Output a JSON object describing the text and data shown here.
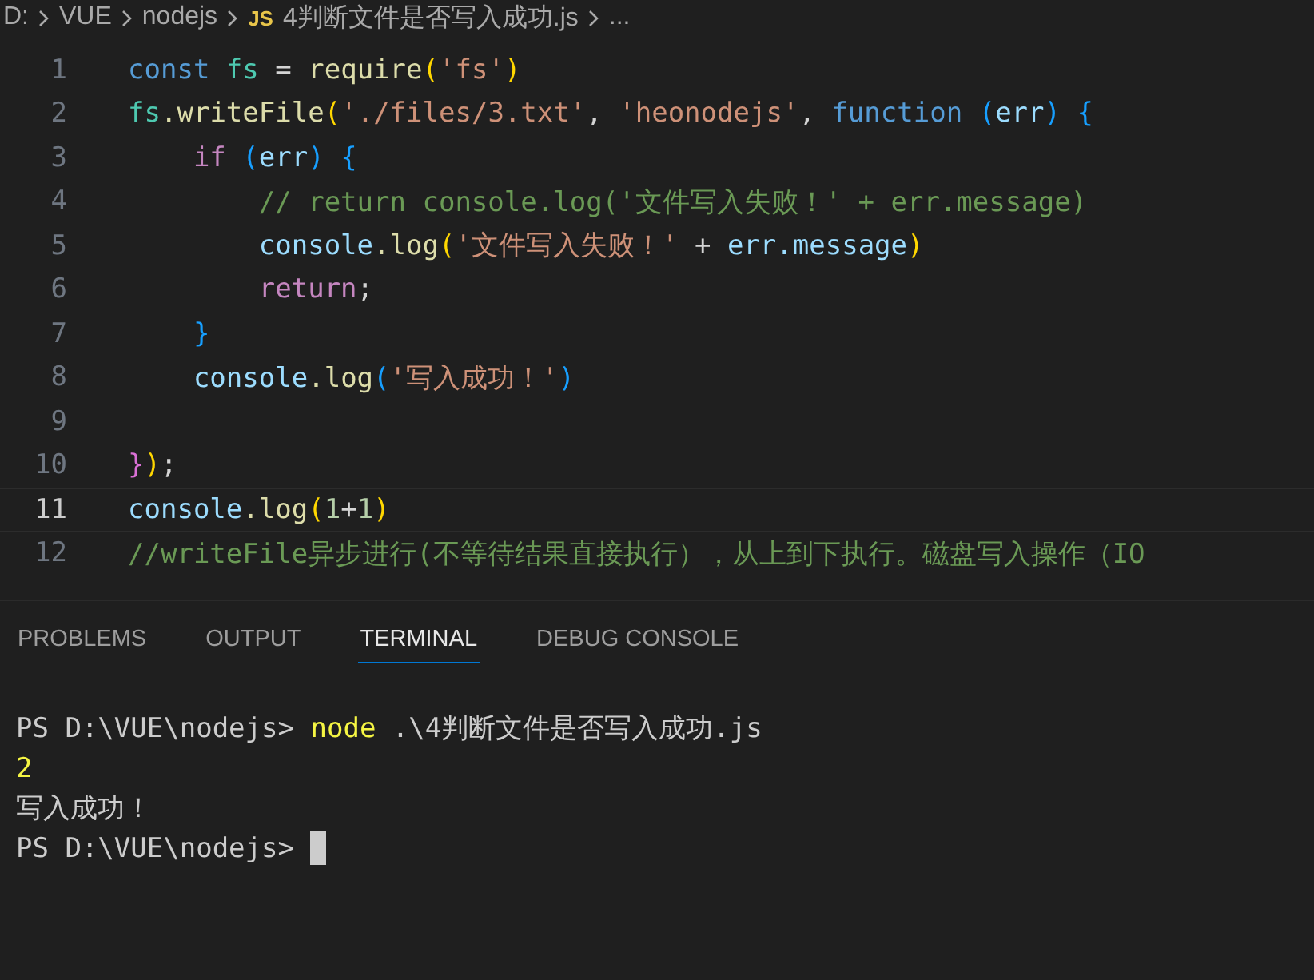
{
  "breadcrumb": [
    {
      "kind": "folder",
      "label": "D:"
    },
    {
      "kind": "folder",
      "label": "VUE"
    },
    {
      "kind": "folder",
      "label": "nodejs"
    },
    {
      "kind": "file",
      "badge": "JS",
      "label": "4判断文件是否写入成功.js"
    },
    {
      "kind": "more",
      "label": "..."
    }
  ],
  "editor": {
    "lines": [
      {
        "number": "1",
        "active": false,
        "tokens": [
          {
            "kind": "keyword",
            "text": "const "
          },
          {
            "kind": "type",
            "text": "fs"
          },
          {
            "kind": "plain",
            "text": " = "
          },
          {
            "kind": "function",
            "text": "require"
          },
          {
            "kind": "paren",
            "text": "("
          },
          {
            "kind": "string",
            "text": "'fs'"
          },
          {
            "kind": "paren",
            "text": ")"
          }
        ]
      },
      {
        "number": "2",
        "active": false,
        "tokens": [
          {
            "kind": "type",
            "text": "fs"
          },
          {
            "kind": "function",
            "text": ".writeFile"
          },
          {
            "kind": "paren",
            "text": "("
          },
          {
            "kind": "string",
            "text": "'./files/3.txt'"
          },
          {
            "kind": "plain",
            "text": ", "
          },
          {
            "kind": "string",
            "text": "'heonodejs'"
          },
          {
            "kind": "plain",
            "text": ", "
          },
          {
            "kind": "keyword",
            "text": "function "
          },
          {
            "kind": "bracket",
            "text": "("
          },
          {
            "kind": "variable",
            "text": "err"
          },
          {
            "kind": "bracket",
            "text": ")"
          },
          {
            "kind": "bracket",
            "text": " {"
          }
        ]
      },
      {
        "number": "3",
        "active": false,
        "tokens": [
          {
            "kind": "control",
            "text": "    if "
          },
          {
            "kind": "bracket",
            "text": "("
          },
          {
            "kind": "variable",
            "text": "err"
          },
          {
            "kind": "bracket",
            "text": ")"
          },
          {
            "kind": "bracket",
            "text": " {"
          }
        ]
      },
      {
        "number": "4",
        "active": false,
        "tokens": [
          {
            "kind": "comment",
            "text": "        // return console.log('文件写入失败！' + err.message)"
          }
        ]
      },
      {
        "number": "5",
        "active": false,
        "tokens": [
          {
            "kind": "variable",
            "text": "        console"
          },
          {
            "kind": "function",
            "text": ".log"
          },
          {
            "kind": "paren",
            "text": "("
          },
          {
            "kind": "string",
            "text": "'文件写入失败！'"
          },
          {
            "kind": "plain",
            "text": " + "
          },
          {
            "kind": "variable",
            "text": "err.message"
          },
          {
            "kind": "paren",
            "text": ")"
          }
        ]
      },
      {
        "number": "6",
        "active": false,
        "tokens": [
          {
            "kind": "control",
            "text": "        return"
          },
          {
            "kind": "plain",
            "text": ";"
          }
        ]
      },
      {
        "number": "7",
        "active": false,
        "tokens": [
          {
            "kind": "bracket",
            "text": "    }"
          }
        ]
      },
      {
        "number": "8",
        "active": false,
        "tokens": [
          {
            "kind": "variable",
            "text": "    console"
          },
          {
            "kind": "function",
            "text": ".log"
          },
          {
            "kind": "bracket",
            "text": "("
          },
          {
            "kind": "string",
            "text": "'写入成功！'"
          },
          {
            "kind": "bracket",
            "text": ")"
          }
        ]
      },
      {
        "number": "9",
        "active": false
      },
      {
        "number": "10",
        "active": false,
        "tokens": [
          {
            "kind": "pink",
            "text": "}"
          },
          {
            "kind": "paren",
            "text": ")"
          },
          {
            "kind": "plain",
            "text": ";"
          }
        ]
      },
      {
        "number": "11",
        "active": true,
        "tokens": [
          {
            "kind": "variable",
            "text": "console"
          },
          {
            "kind": "function",
            "text": ".log"
          },
          {
            "kind": "paren",
            "text": "("
          },
          {
            "kind": "number",
            "text": "1"
          },
          {
            "kind": "plain",
            "text": "+"
          },
          {
            "kind": "number",
            "text": "1"
          },
          {
            "kind": "paren",
            "text": ")"
          }
        ]
      },
      {
        "number": "12",
        "active": false,
        "tokens": [
          {
            "kind": "comment",
            "text": "//writeFile异步进行(不等待结果直接执行），从上到下执行。磁盘写入操作（IO"
          }
        ]
      }
    ]
  },
  "panel": {
    "tabs": [
      {
        "label": "PROBLEMS",
        "selected": false
      },
      {
        "label": "OUTPUT",
        "selected": false
      },
      {
        "label": "TERMINAL",
        "selected": true
      },
      {
        "label": "DEBUG CONSOLE",
        "selected": false
      }
    ],
    "terminal": [
      {
        "kind": "command",
        "prompt": "PS D:\\VUE\\nodejs> ",
        "command": "node",
        "args": " .\\4判断文件是否写入成功.js"
      },
      {
        "kind": "number",
        "text": "2"
      },
      {
        "kind": "output",
        "text": "写入成功！"
      },
      {
        "kind": "cursor",
        "prompt": "PS D:\\VUE\\nodejs> "
      }
    ]
  }
}
